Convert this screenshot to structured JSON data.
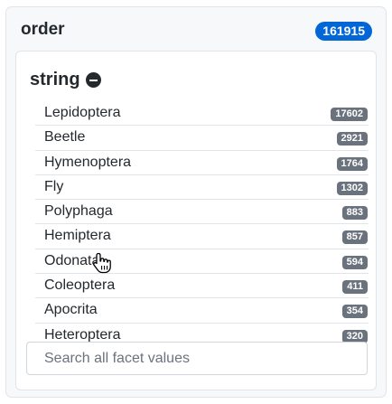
{
  "facet": {
    "title": "order",
    "total": "161915"
  },
  "group": {
    "title": "string",
    "remove_icon": "minus-circle-icon"
  },
  "values": [
    {
      "label": "Lepidoptera",
      "count": "17602"
    },
    {
      "label": "Beetle",
      "count": "2921"
    },
    {
      "label": "Hymenoptera",
      "count": "1764"
    },
    {
      "label": "Fly",
      "count": "1302"
    },
    {
      "label": "Polyphaga",
      "count": "883"
    },
    {
      "label": "Hemiptera",
      "count": "857"
    },
    {
      "label": "Odonata",
      "count": "594"
    },
    {
      "label": "Coleoptera",
      "count": "411"
    },
    {
      "label": "Apocrita",
      "count": "354"
    },
    {
      "label": "Heteroptera",
      "count": "320"
    }
  ],
  "search": {
    "placeholder": "Search all facet values"
  },
  "colors": {
    "total_badge": "#0366d6",
    "count_badge": "#6a737d"
  },
  "pointer": "hand-pointer-icon"
}
